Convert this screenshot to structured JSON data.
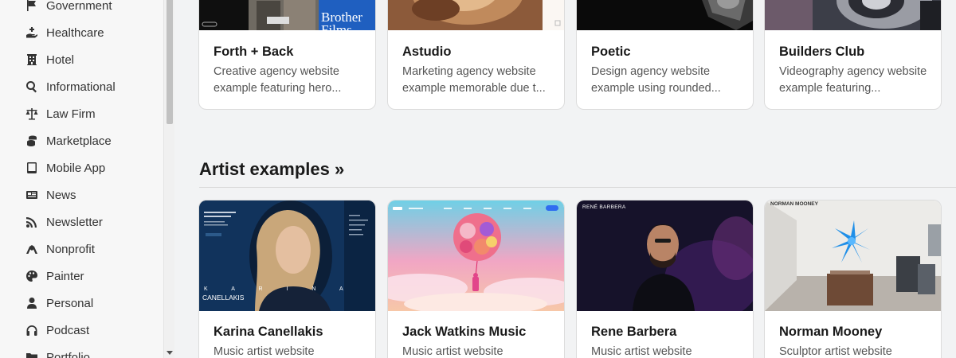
{
  "sidebar": {
    "items": [
      {
        "label": "Government",
        "icon": "flag-icon"
      },
      {
        "label": "Healthcare",
        "icon": "hand-holding-medical-icon"
      },
      {
        "label": "Hotel",
        "icon": "hotel-icon"
      },
      {
        "label": "Informational",
        "icon": "search-icon"
      },
      {
        "label": "Law Firm",
        "icon": "scale-balance-icon"
      },
      {
        "label": "Marketplace",
        "icon": "coins-icon"
      },
      {
        "label": "Mobile App",
        "icon": "tablet-icon"
      },
      {
        "label": "News",
        "icon": "newspaper-icon"
      },
      {
        "label": "Newsletter",
        "icon": "rss-icon"
      },
      {
        "label": "Nonprofit",
        "icon": "hands-helping-icon"
      },
      {
        "label": "Painter",
        "icon": "palette-icon"
      },
      {
        "label": "Personal",
        "icon": "user-icon"
      },
      {
        "label": "Podcast",
        "icon": "headphones-icon"
      },
      {
        "label": "Portfolio",
        "icon": "folder-icon"
      }
    ]
  },
  "agency_cards": [
    {
      "title": "Forth + Back",
      "description": "Creative agency website example featuring hero...",
      "thumb_text": "Brother Films"
    },
    {
      "title": "Astudio",
      "description": "Marketing agency website example memorable due t..."
    },
    {
      "title": "Poetic",
      "description": "Design agency website example using rounded..."
    },
    {
      "title": "Builders Club",
      "description": "Videography agency website example featuring..."
    }
  ],
  "artist_section": {
    "heading": "Artist examples »"
  },
  "artist_cards": [
    {
      "title": "Karina Canellakis",
      "description": "Music artist website",
      "thumb_text": "K A R I N A",
      "thumb_text2": "CANELLAKIS"
    },
    {
      "title": "Jack Watkins Music",
      "description": "Music artist website"
    },
    {
      "title": "Rene Barbera",
      "description": "Music artist website",
      "thumb_text": "RENÉ BARBERA"
    },
    {
      "title": "Norman Mooney",
      "description": "Sculptor artist website",
      "thumb_text": "NORMAN MOONEY"
    }
  ]
}
